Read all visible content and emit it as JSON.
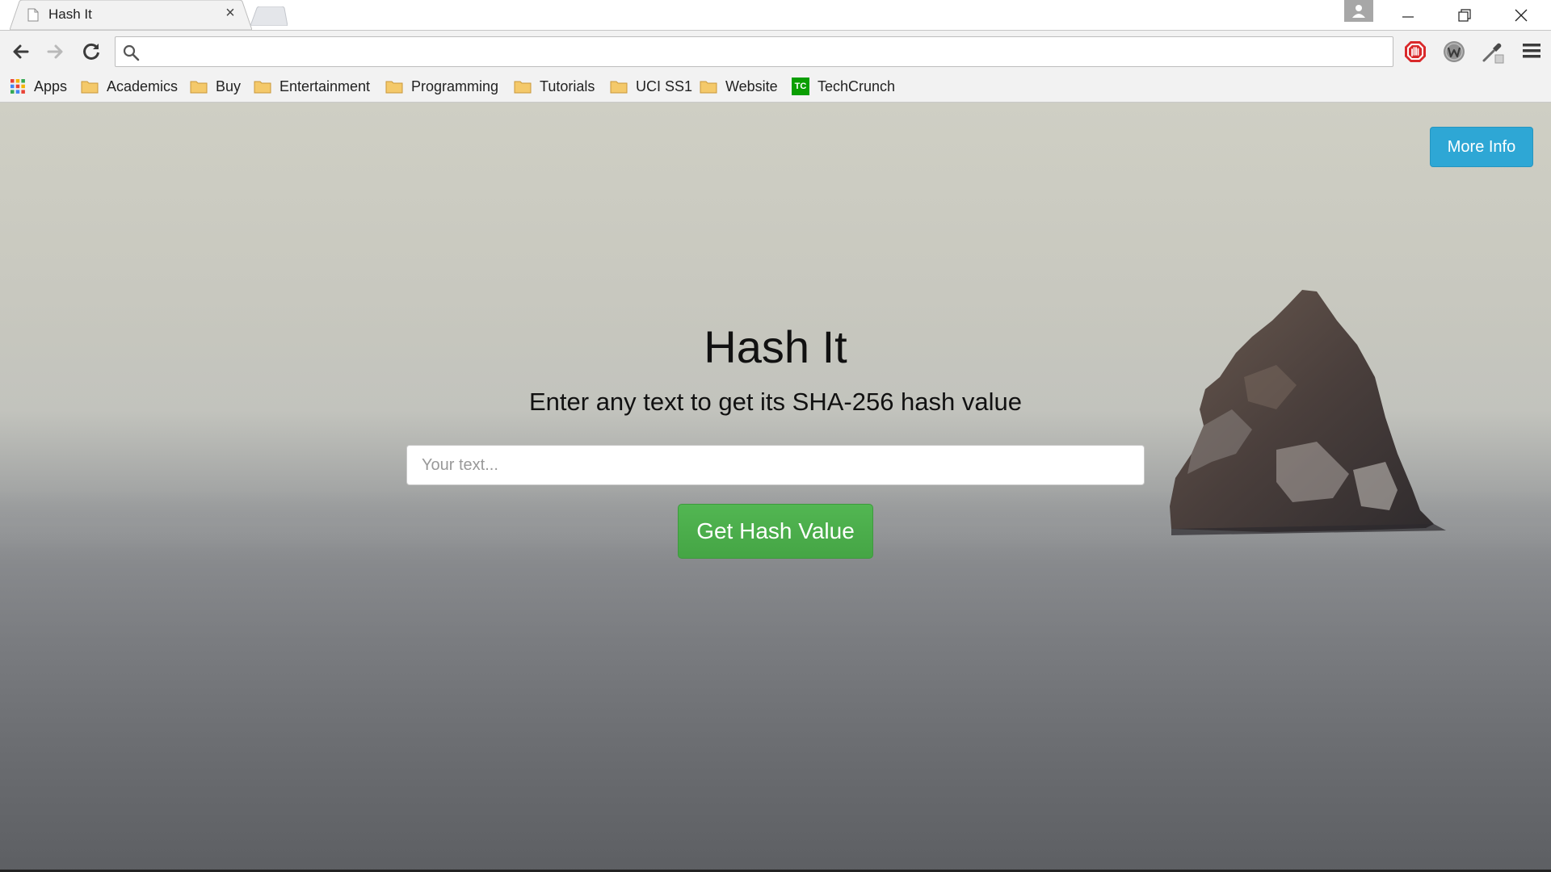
{
  "browser": {
    "tab_title": "Hash It",
    "tab_close": "×",
    "omnibox_value": "",
    "icons": {
      "back": "arrow-left-icon",
      "forward": "arrow-right-icon",
      "reload": "reload-icon",
      "search": "search-icon",
      "menu": "hamburger-menu-icon",
      "profile": "user-profile-icon",
      "extensions": [
        "stop-hand-icon",
        "w-extension-icon",
        "eyedropper-icon"
      ]
    }
  },
  "bookmarks": {
    "items": [
      {
        "label": "Apps",
        "icon": "apps-grid-icon"
      },
      {
        "label": "Academics",
        "icon": "folder-icon"
      },
      {
        "label": "Buy",
        "icon": "folder-icon"
      },
      {
        "label": "Entertainment",
        "icon": "folder-icon"
      },
      {
        "label": "Programming",
        "icon": "folder-icon"
      },
      {
        "label": "Tutorials",
        "icon": "folder-icon"
      },
      {
        "label": "UCI SS1",
        "icon": "folder-icon"
      },
      {
        "label": "Website",
        "icon": "folder-icon"
      },
      {
        "label": "TechCrunch",
        "icon": "techcrunch-icon"
      }
    ],
    "techcrunch_icon_text": "TC"
  },
  "page": {
    "more_info_label": "More Info",
    "title": "Hash It",
    "subtitle": "Enter any text to get its SHA-256 hash value",
    "input_placeholder": "Your text...",
    "input_value": "",
    "submit_label": "Get Hash Value"
  },
  "colors": {
    "more_info_bg": "#2ea7d5",
    "submit_bg": "#4cae4c",
    "stop_icon": "#d9292b",
    "techcrunch_green": "#0a9e01",
    "folder": "#f4c96a"
  }
}
